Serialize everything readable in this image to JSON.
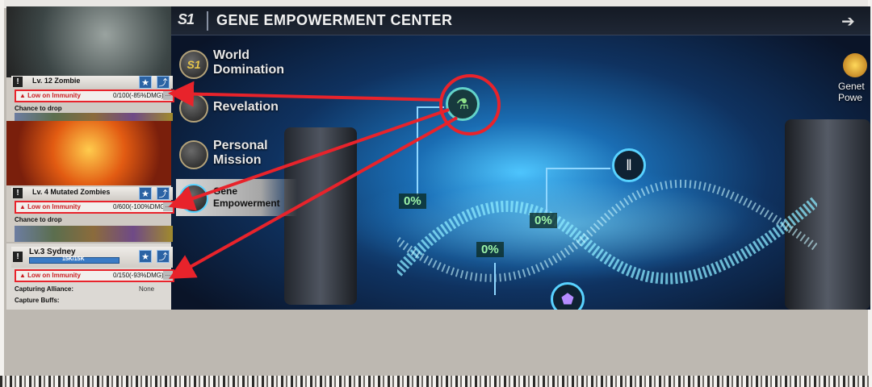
{
  "header": {
    "logo": "S1",
    "title": "GENE EMPOWERMENT CENTER",
    "right_icon": "back-icon"
  },
  "menu": {
    "items": [
      {
        "icon_text": "S1",
        "label_line1": "World",
        "label_line2": "Domination"
      },
      {
        "icon_text": "",
        "label_line1": "Revelation",
        "label_line2": ""
      },
      {
        "icon_text": "",
        "label_line1": "Personal",
        "label_line2": "Mission"
      },
      {
        "icon_text": "",
        "label_line1": "Gene",
        "label_line2": "Empowerment"
      }
    ]
  },
  "nodes": {
    "pct_1": "0%",
    "pct_2": "0%",
    "pct_3": "0%"
  },
  "side": {
    "label_line1": "Genet",
    "label_line2": "Powe"
  },
  "cards": [
    {
      "title": "Lv. 12 Zombie",
      "immunity_label": "Low on Immunity",
      "immunity_value": "0/100(-85%DMG)",
      "drop_label": "Chance to drop"
    },
    {
      "title": "Lv. 4 Mutated Zombies",
      "immunity_label": "Low on Immunity",
      "immunity_value": "0/600(-100%DMG)",
      "drop_label": "Chance to drop"
    },
    {
      "title": "Lv.3 Sydney",
      "hp": "15K/15K",
      "immunity_label": "Low on Immunity",
      "immunity_value": "0/150(-93%DMG)",
      "capturing_label": "Capturing Alliance:",
      "capturing_value": "None",
      "buffs_label": "Capture Buffs:"
    }
  ],
  "colors": {
    "highlight": "#e8232b",
    "node_ring": "#58d2ff",
    "pct_text": "#9cf4a9",
    "button_blue": "#2b63a4"
  }
}
